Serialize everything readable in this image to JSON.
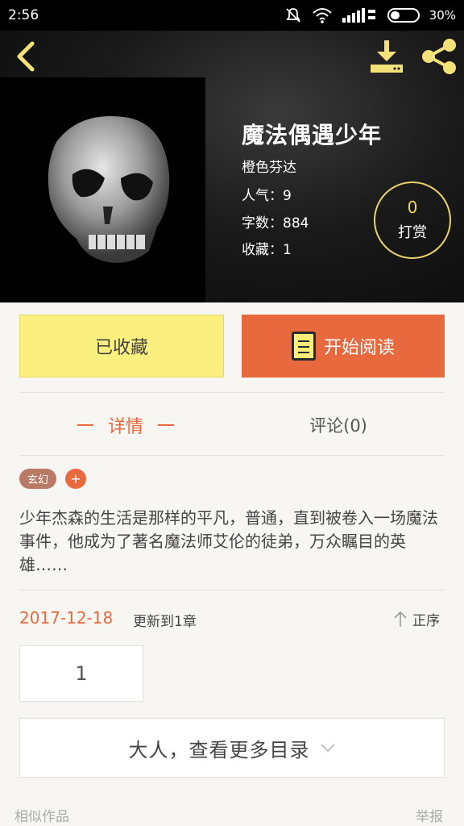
{
  "status_bar": {
    "time": "2:56",
    "battery_percent": "30%"
  },
  "header": {
    "book_title": "魔法偶遇少年",
    "author": "橙色芬达",
    "popularity": "人气：9",
    "word_count": "字数：884",
    "favorites": "收藏：1",
    "reward": {
      "count": "0",
      "label": "打赏"
    }
  },
  "actions": {
    "collected_label": "已收藏",
    "read_label": "开始阅读"
  },
  "tabs": {
    "details": "详情",
    "comments": "评论(0)"
  },
  "tags": {
    "genre": "玄幻",
    "add": "+"
  },
  "description": "少年杰森的生活是那样的平凡，普通，直到被卷入一场魔法事件，他成为了著名魔法师艾伦的徒弟，万众瞩目的英雄……",
  "update": {
    "date": "2017-12-18",
    "text": "更新到1章",
    "sort_label": "正序"
  },
  "chapter_number": "1",
  "more_catalog_label": "大人，查看更多目录",
  "footer": {
    "similar_works": "相似作品",
    "report": "举报"
  },
  "colors": {
    "accent": "#e8693e",
    "collected_bg": "#fbf07f",
    "reward_ring": "#e8d26a"
  }
}
